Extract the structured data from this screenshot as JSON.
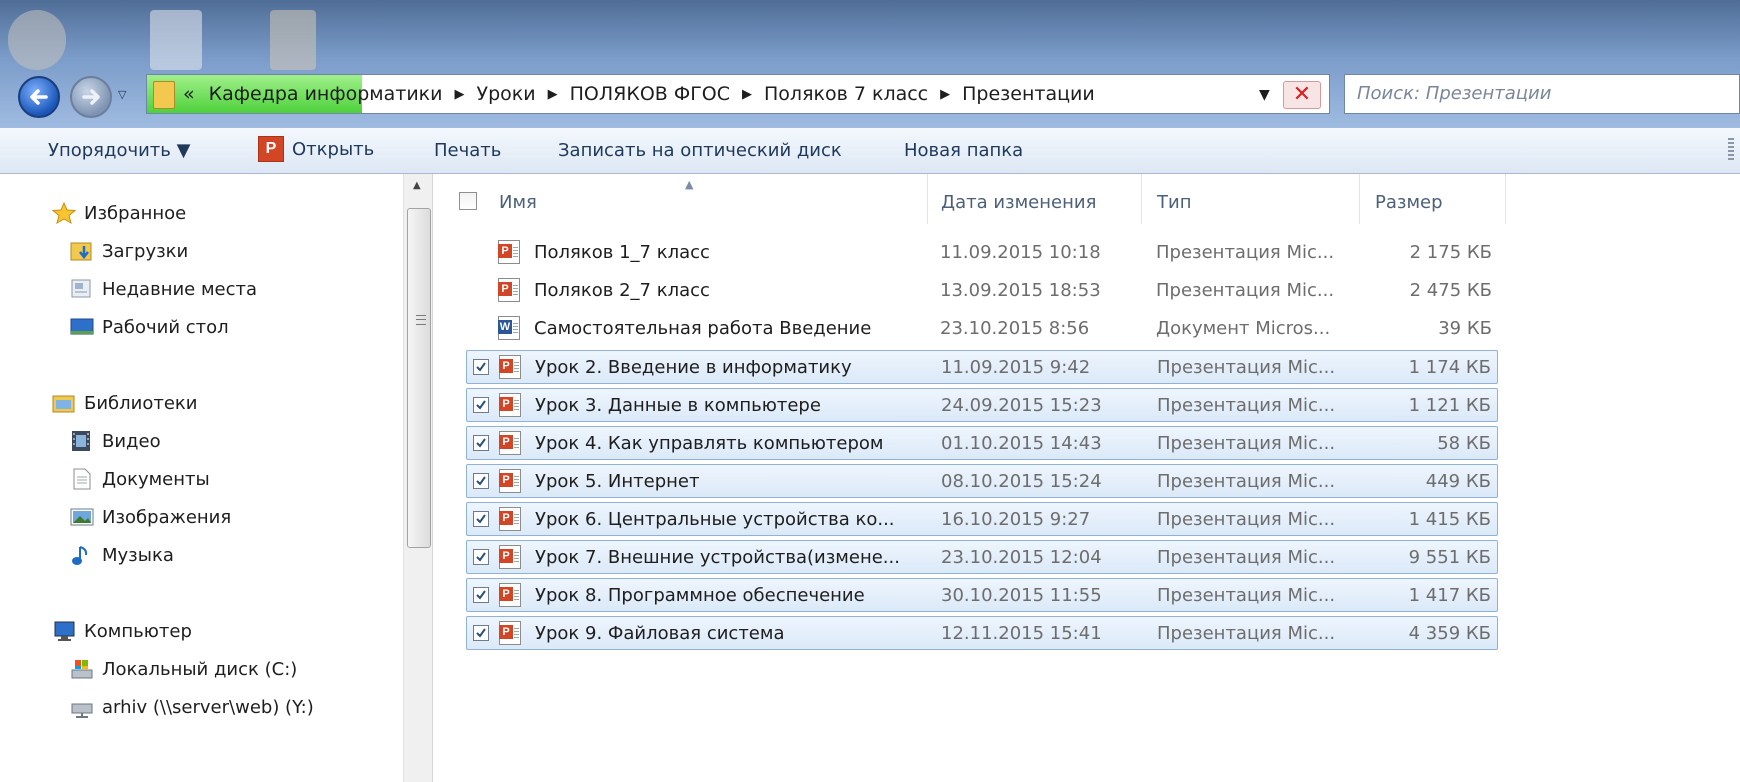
{
  "address": {
    "lead": "«",
    "crumbs": [
      "Кафедра информатики",
      "Уроки",
      "ПОЛЯКОВ ФГОС",
      "Поляков 7 класс",
      "Презентации"
    ],
    "sep": "▶"
  },
  "search": {
    "placeholder": "Поиск: Презентации"
  },
  "toolbar": {
    "organize": "Упорядочить ▼",
    "open": "Открыть",
    "print": "Печать",
    "burn": "Записать на оптический диск",
    "new_folder": "Новая папка"
  },
  "sidebar": {
    "favorites": "Избранное",
    "downloads": "Загрузки",
    "recent": "Недавние места",
    "desktop": "Рабочий стол",
    "libraries": "Библиотеки",
    "video": "Видео",
    "documents": "Документы",
    "images": "Изображения",
    "music": "Музыка",
    "computer": "Компьютер",
    "local_disk": "Локальный диск (C:)",
    "network_drive": "arhiv (\\\\server\\web) (Y:)"
  },
  "columns": {
    "name": "Имя",
    "date": "Дата изменения",
    "type": "Тип",
    "size": "Размер"
  },
  "files": [
    {
      "name": "Поляков 1_7 класс",
      "date": "11.09.2015 10:18",
      "type": "Презентация Mic...",
      "size": "2 175 КБ",
      "kind": "ppt",
      "selected": false
    },
    {
      "name": "Поляков 2_7 класс",
      "date": "13.09.2015 18:53",
      "type": "Презентация Mic...",
      "size": "2 475 КБ",
      "kind": "ppt",
      "selected": false
    },
    {
      "name": "Самостоятельная работа Введение",
      "date": "23.10.2015 8:56",
      "type": "Документ Micros...",
      "size": "39 КБ",
      "kind": "doc",
      "selected": false
    },
    {
      "name": "Урок 2. Введение в информатику",
      "date": "11.09.2015 9:42",
      "type": "Презентация Mic...",
      "size": "1 174 КБ",
      "kind": "ppt",
      "selected": true
    },
    {
      "name": "Урок 3. Данные в компьютере",
      "date": "24.09.2015 15:23",
      "type": "Презентация Mic...",
      "size": "1 121 КБ",
      "kind": "ppt",
      "selected": true
    },
    {
      "name": "Урок 4. Как управлять компьютером",
      "date": "01.10.2015 14:43",
      "type": "Презентация Mic...",
      "size": "58 КБ",
      "kind": "ppt",
      "selected": true
    },
    {
      "name": "Урок 5. Интернет",
      "date": "08.10.2015 15:24",
      "type": "Презентация Mic...",
      "size": "449 КБ",
      "kind": "ppt",
      "selected": true
    },
    {
      "name": "Урок 6. Центральные устройства ко...",
      "date": "16.10.2015 9:27",
      "type": "Презентация Mic...",
      "size": "1 415 КБ",
      "kind": "ppt",
      "selected": true
    },
    {
      "name": "Урок 7. Внешние устройства(измене...",
      "date": "23.10.2015 12:04",
      "type": "Презентация Mic...",
      "size": "9 551 КБ",
      "kind": "ppt",
      "selected": true
    },
    {
      "name": "Урок 8. Программное обеспечение",
      "date": "30.10.2015 11:55",
      "type": "Презентация Mic...",
      "size": "1 417 КБ",
      "kind": "ppt",
      "selected": true
    },
    {
      "name": "Урок 9. Файловая система",
      "date": "12.11.2015 15:41",
      "type": "Презентация Mic...",
      "size": "4 359 КБ",
      "kind": "ppt",
      "selected": true
    }
  ],
  "icon_letters": {
    "ppt": "P",
    "doc": "W"
  },
  "colors": {
    "selection_bg": "#dbe9f8",
    "selection_border": "#8fb2da",
    "ppt": "#d24625",
    "word": "#2b5797"
  }
}
